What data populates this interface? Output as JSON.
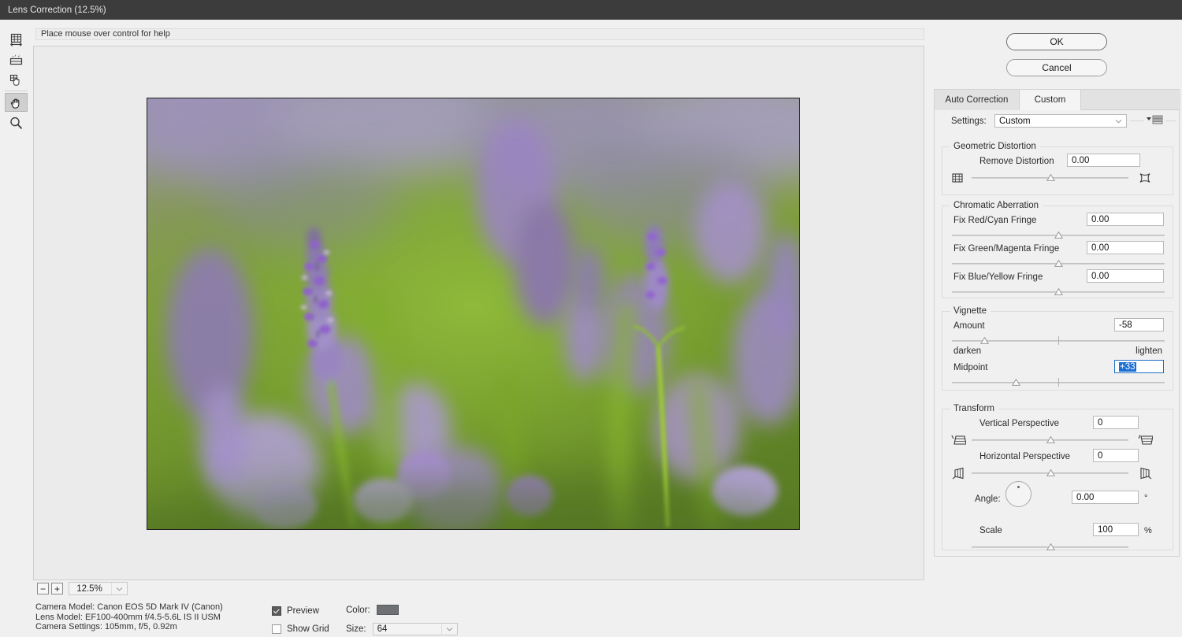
{
  "window": {
    "title": "Lens Correction (12.5%)"
  },
  "help": {
    "text": "Place mouse over control for help"
  },
  "toolbar": {
    "items": [
      {
        "name": "remove-distortion-tool",
        "label": "Remove Distortion Tool",
        "active": false
      },
      {
        "name": "straighten-tool",
        "label": "Straighten Tool",
        "active": false
      },
      {
        "name": "move-grid-tool",
        "label": "Move Grid Tool",
        "active": false
      },
      {
        "name": "hand-tool",
        "label": "Hand Tool",
        "active": true
      },
      {
        "name": "zoom-tool",
        "label": "Zoom Tool",
        "active": false
      }
    ]
  },
  "preview": {
    "subject": "blurred lavender field close-up",
    "zoom_level": "12.5%",
    "zoom_out_label": "−",
    "zoom_in_label": "+"
  },
  "camera_info": {
    "camera_model": "Camera Model: Canon EOS 5D Mark IV (Canon)",
    "lens_model": "Lens Model: EF100-400mm f/4.5-5.6L IS II USM",
    "camera_settings": "Camera Settings: 105mm, f/5, 0.92m"
  },
  "options": {
    "preview_label": "Preview",
    "preview_checked": true,
    "show_grid_label": "Show Grid",
    "show_grid_checked": false,
    "color_label": "Color:",
    "color_value": "#6e7073",
    "size_label": "Size:",
    "size_value": "64"
  },
  "buttons": {
    "ok": "OK",
    "cancel": "Cancel"
  },
  "panel": {
    "tabs": [
      {
        "label": "Auto Correction",
        "active": false
      },
      {
        "label": "Custom",
        "active": true
      }
    ],
    "settings": {
      "label": "Settings:",
      "value": "Custom"
    },
    "geometric_distortion": {
      "title": "Geometric Distortion",
      "remove_distortion": {
        "label": "Remove Distortion",
        "value": "0.00",
        "slider_percent": 50,
        "left_icon": "barrel-distortion-icon",
        "right_icon": "pincushion-distortion-icon"
      }
    },
    "chromatic_aberration": {
      "title": "Chromatic Aberration",
      "fields": [
        {
          "label": "Fix Red/Cyan Fringe",
          "value": "0.00",
          "slider_percent": 50
        },
        {
          "label": "Fix Green/Magenta Fringe",
          "value": "0.00",
          "slider_percent": 50
        },
        {
          "label": "Fix Blue/Yellow Fringe",
          "value": "0.00",
          "slider_percent": 50
        }
      ]
    },
    "vignette": {
      "title": "Vignette",
      "amount": {
        "label": "Amount",
        "value": "-58",
        "slider_percent": 15,
        "left_hint": "darken",
        "right_hint": "lighten"
      },
      "midpoint": {
        "label": "Midpoint",
        "value": "+33",
        "slider_percent": 30,
        "focused": true,
        "selected": true
      }
    },
    "transform": {
      "title": "Transform",
      "vertical_perspective": {
        "label": "Vertical Perspective",
        "value": "0",
        "slider_percent": 50,
        "left_icon": "perspective-top-narrow-icon",
        "right_icon": "perspective-bottom-narrow-icon"
      },
      "horizontal_perspective": {
        "label": "Horizontal Perspective",
        "value": "0",
        "slider_percent": 50,
        "left_icon": "perspective-left-narrow-icon",
        "right_icon": "perspective-right-narrow-icon"
      },
      "angle": {
        "label": "Angle:",
        "value": "0.00",
        "unit": "°",
        "dial_degrees": 0
      },
      "scale": {
        "label": "Scale",
        "value": "100",
        "unit": "%",
        "slider_percent": 50
      }
    }
  }
}
